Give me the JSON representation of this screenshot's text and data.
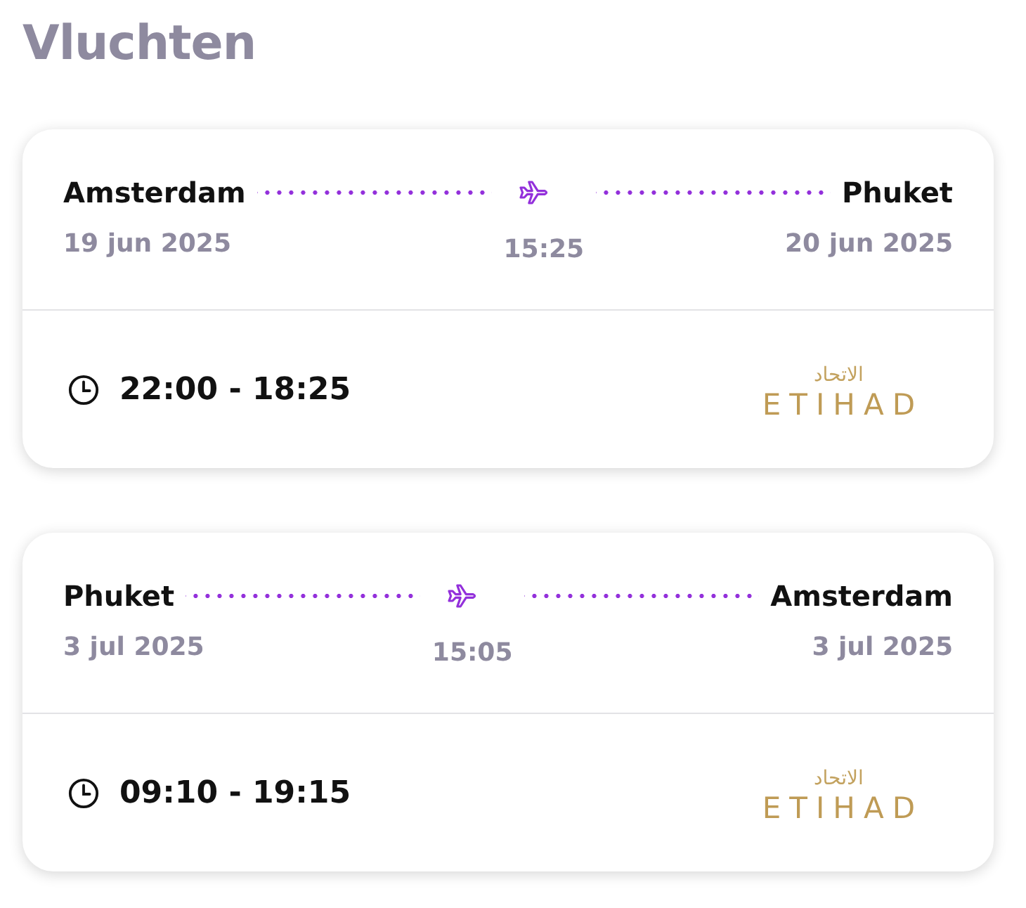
{
  "title": "Vluchten",
  "flights": [
    {
      "from": {
        "city": "Amsterdam",
        "date": "19 jun 2025"
      },
      "to": {
        "city": "Phuket",
        "date": "20 jun 2025"
      },
      "duration": "15:25",
      "times": "22:00 - 18:25",
      "airline_logo": {
        "arabic": "الاتحاد",
        "wordmark": "ETIHAD"
      }
    },
    {
      "from": {
        "city": "Phuket",
        "date": "3 jul 2025"
      },
      "to": {
        "city": "Amsterdam",
        "date": "3 jul 2025"
      },
      "duration": "15:05",
      "times": "09:10 - 19:15",
      "airline_logo": {
        "arabic": "الاتحاد",
        "wordmark": "ETIHAD"
      }
    }
  ]
}
